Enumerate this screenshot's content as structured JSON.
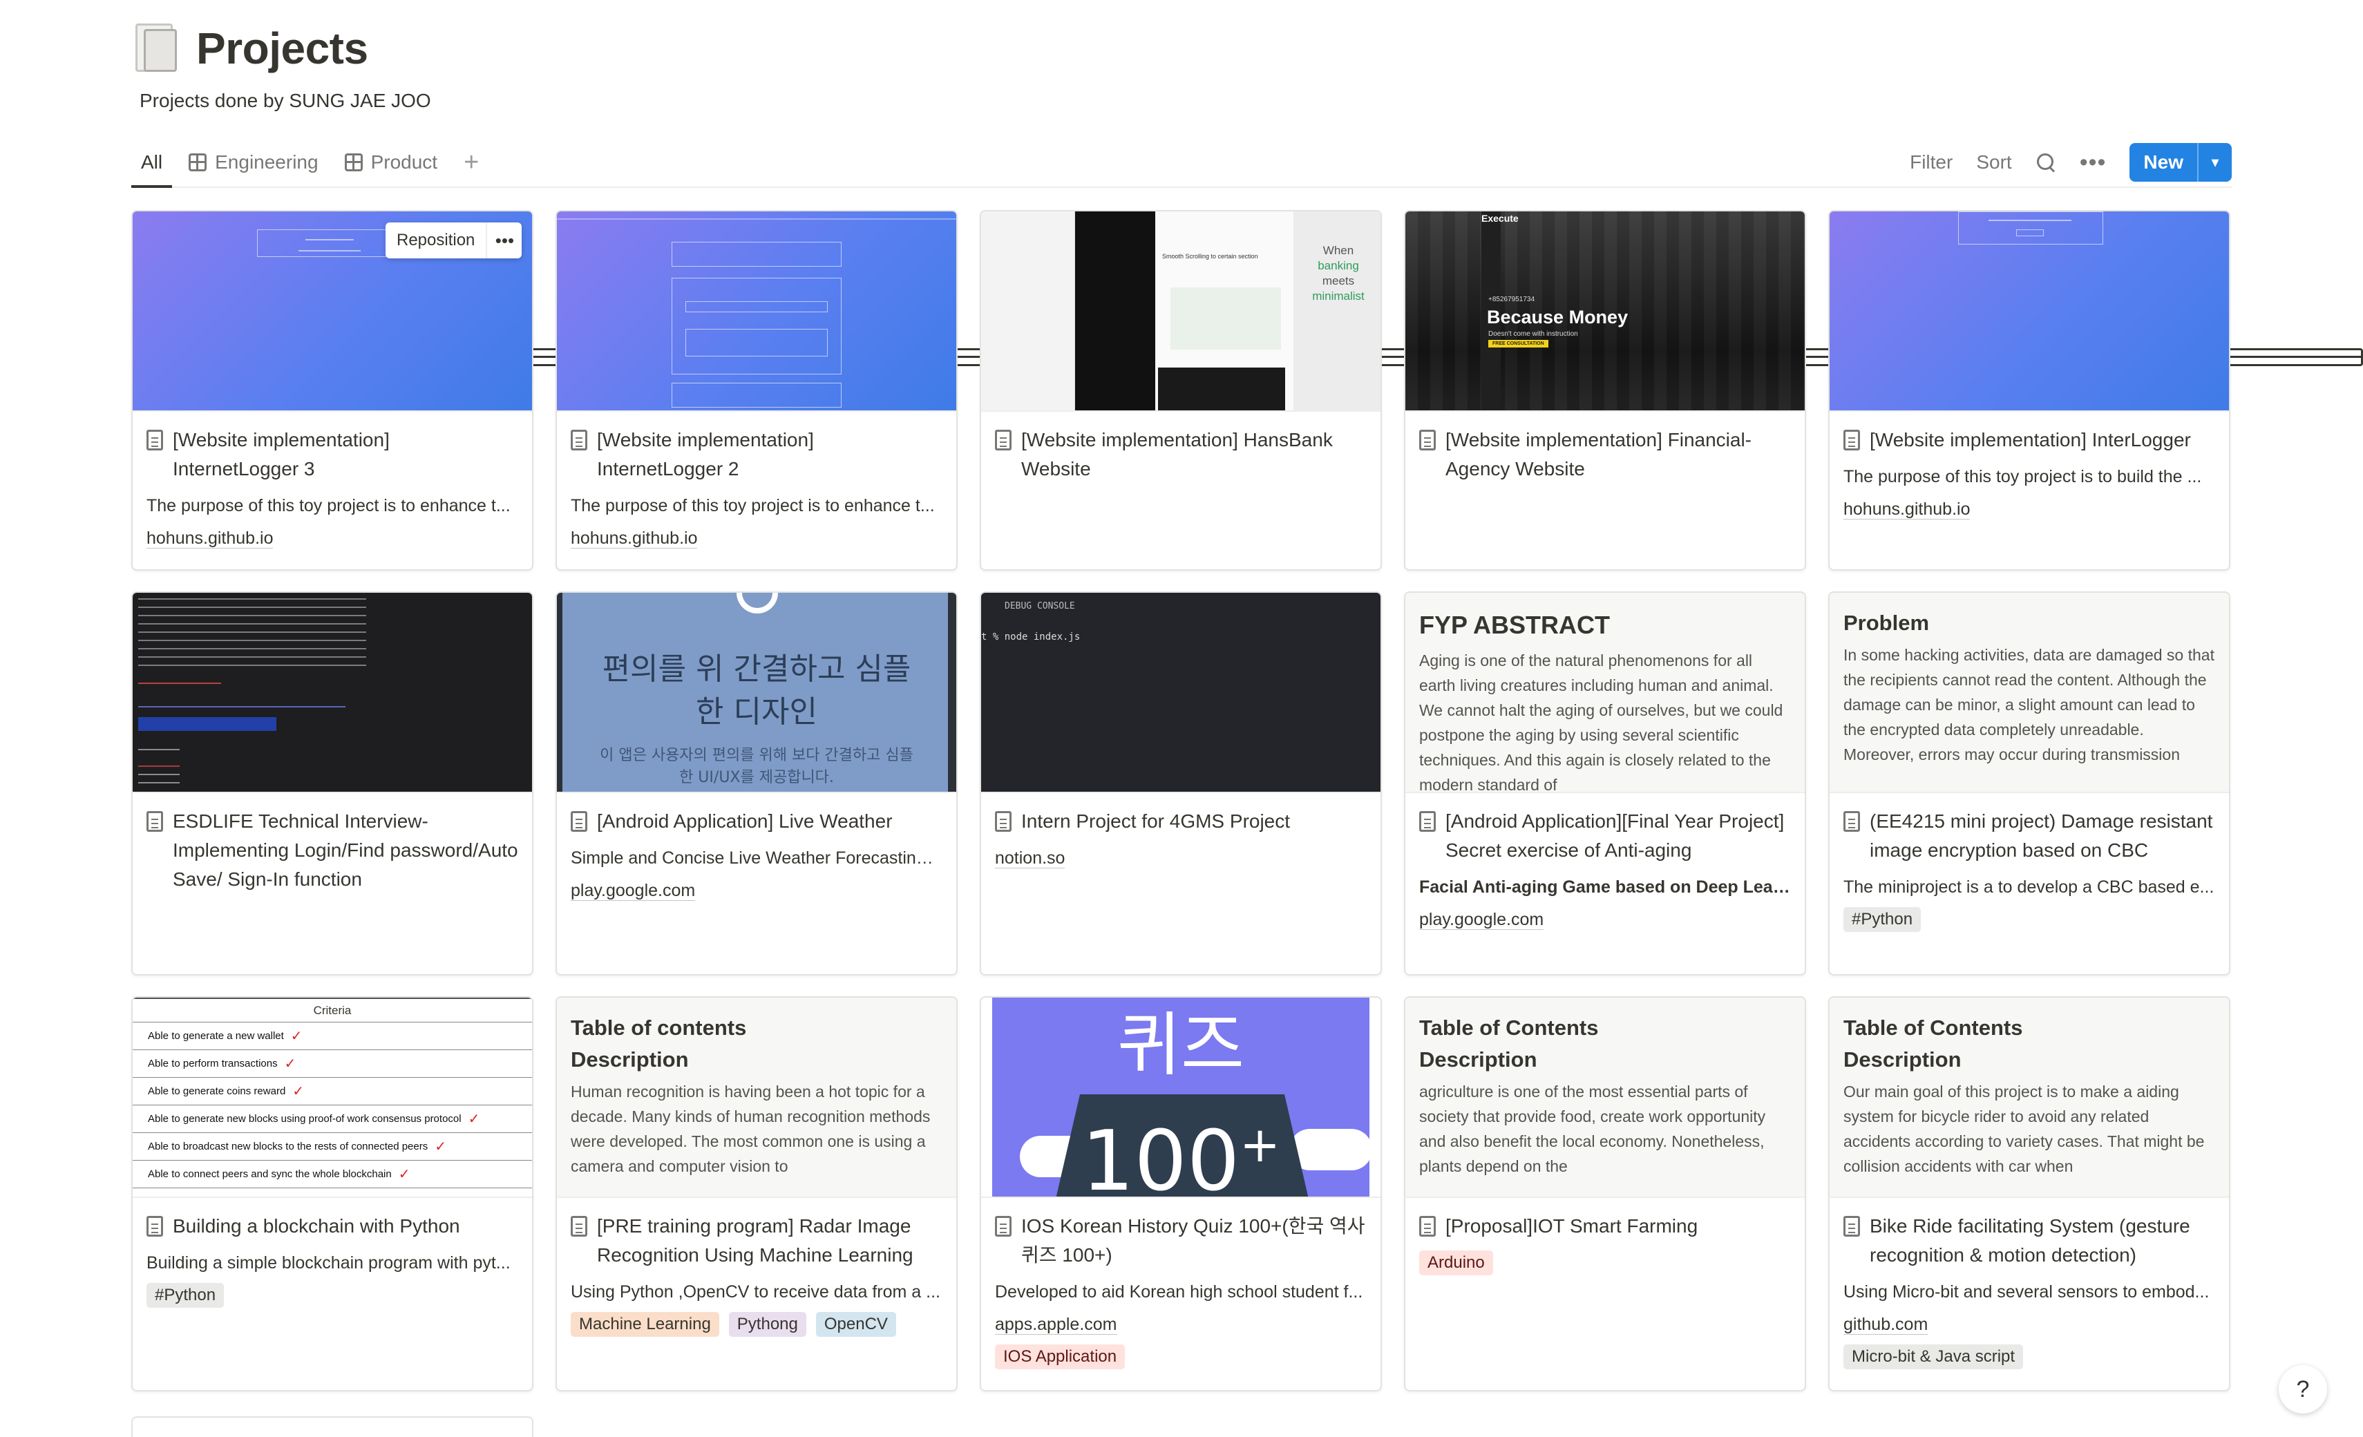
{
  "page": {
    "title": "Projects",
    "subtitle": "Projects done by SUNG JAE JOO",
    "icon": "document-stack-icon"
  },
  "toolbar": {
    "tabs": [
      {
        "label": "All",
        "icon": "gallery-icon",
        "active": true
      },
      {
        "label": "Engineering",
        "icon": "table-icon",
        "active": false
      },
      {
        "label": "Product",
        "icon": "table-icon",
        "active": false
      }
    ],
    "add_view": "+",
    "filter": "Filter",
    "sort": "Sort",
    "more": "•••",
    "new_label": "New",
    "new_caret": "⌄"
  },
  "reposition": {
    "label": "Reposition",
    "more": "•••"
  },
  "cards": [
    {
      "title": "[Website implementation] InternetLogger 3",
      "desc": "The purpose of this toy project is to enhance t...",
      "link": "hohuns.github.io",
      "cover": "purple-gradient-login"
    },
    {
      "title": "[Website implementation] InternetLogger 2",
      "desc": "The purpose of this toy project is to enhance t...",
      "link": "hohuns.github.io",
      "cover": "purple-gradient-form"
    },
    {
      "title": "[Website implementation] HansBank Website",
      "cover": "bank-website",
      "cover_text": {
        "banner": "Smooth Scrolling to certain section",
        "right_1": "When",
        "right_2": "banking",
        "right_3": "meets",
        "right_4": "minimalist"
      }
    },
    {
      "title": "[Website implementation] Financial-Agency Website",
      "cover": "dark-building",
      "cover_text": {
        "brand": "Execute",
        "phone": "+85267951734",
        "headline": "Because Money",
        "tagline": "Doesn't come with instruction",
        "cta": "FREE CONSULTATION"
      }
    },
    {
      "title": "[Website implementation] InterLogger",
      "desc": "The purpose of this toy project is to build the ...",
      "link": "hohuns.github.io",
      "cover": "purple-gradient-simple"
    },
    {
      "title": "ESDLIFE Technical Interview- Implementing Login/Find password/Auto Save/ Sign-In function",
      "cover": "dark-email"
    },
    {
      "title": "[Android Application] Live Weather",
      "desc": "Simple and Concise Live Weather Forecasting ...",
      "link": "play.google.com",
      "cover": "korean-blue",
      "cover_text": {
        "line1": "편의를 위 간결하고 심플",
        "line2": "한 디자인",
        "sub1": "이 앱은 사용자의 편의를 위해 보다 간결하고 심플",
        "sub2": "한 UI/UX를 제공합니다."
      }
    },
    {
      "title": "Intern Project for 4GMS Project",
      "link": "notion.so",
      "cover": "debug-console",
      "cover_text": {
        "console": "DEBUG CONSOLE",
        "command": "t % node index.js"
      }
    },
    {
      "title": "[Android Application][Final Year Project] Secret exercise of Anti-aging",
      "desc_bold": "Facial Anti-aging Game based on Deep Lear...",
      "link": "play.google.com",
      "cover": "text-page",
      "cover_text": {
        "heading": "FYP ABSTRACT",
        "body": "Aging is one of the natural phenomenons for all earth living creatures including human and animal. We cannot halt the aging of ourselves, but we could postpone the aging by using several scientific techniques. And this again is closely related to the modern standard of"
      }
    },
    {
      "title": "(EE4215 mini project) Damage resistant image encryption based on CBC",
      "desc": "The miniproject is a to develop a CBC based e...",
      "tags": [
        {
          "label": "#Python",
          "color": "#e9e9e7"
        }
      ],
      "cover": "text-page",
      "cover_text": {
        "heading": "Problem",
        "body": "In some hacking activities, data are damaged so that the recipients cannot read the content. Although the damage can be minor, a slight amount can lead to the encrypted data completely unreadable. Moreover, errors may occur during transmission"
      }
    },
    {
      "title": "Building a blockchain with Python",
      "desc": "Building a simple blockchain program with pyt...",
      "tags": [
        {
          "label": "#Python",
          "color": "#e9e9e7"
        }
      ],
      "cover": "criteria-table",
      "cover_text": {
        "header": "Criteria",
        "rows": [
          "Able to generate a new wallet",
          "Able to perform transactions",
          "Able to generate coins reward",
          "Able to generate new blocks using proof-of work  consensus protocol",
          "Able to broadcast new blocks to the rests of connected peers",
          "Able to connect peers and sync the whole blockchain"
        ]
      }
    },
    {
      "title": "[PRE training program] Radar Image Recognition Using Machine Learning",
      "desc": "Using Python ,OpenCV to receive data from a ...",
      "tags": [
        {
          "label": "Machine Learning",
          "color": "#fadec9"
        },
        {
          "label": "Pythong",
          "color": "#e8deee"
        },
        {
          "label": "OpenCV",
          "color": "#d3e5ef"
        }
      ],
      "cover": "text-page",
      "cover_text": {
        "heading": "Table of contents",
        "sub": "Description",
        "body": "Human recognition is having been a hot topic for a decade. Many kinds of human recognition methods were developed. The most common one is using a camera and computer vision to"
      }
    },
    {
      "title": "IOS Korean History Quiz 100+(한국 역사 퀴즈 100+)",
      "desc": "Developed to aid Korean high school student f...",
      "link": "apps.apple.com",
      "tags": [
        {
          "label": "IOS Application",
          "color": "#ffe2dd"
        }
      ],
      "cover": "quiz",
      "cover_text": {
        "line1": "퀴즈",
        "line2": "100",
        "plus": "+"
      }
    },
    {
      "title": "[Proposal]IOT Smart Farming",
      "tags": [
        {
          "label": "Arduino",
          "color": "#ffe2dd"
        }
      ],
      "cover": "text-page",
      "cover_text": {
        "heading": "Table of Contents",
        "sub": "Description",
        "body": "agriculture is one of the most essential parts of society that provide food, create work opportunity and also benefit the local economy. Nonetheless, plants depend on the"
      }
    },
    {
      "title": "Bike Ride facilitating System (gesture recognition & motion detection)",
      "desc": "Using Micro-bit and several sensors to embod...",
      "link": "github.com",
      "tags": [
        {
          "label": "Micro-bit & Java script",
          "color": "#e9e9e7"
        }
      ],
      "cover": "text-page",
      "cover_text": {
        "heading": "Table of Contents",
        "sub": "Description",
        "body": "Our main goal of this project is to make a aiding system for bicycle rider to avoid any related accidents according to variety cases. That might be collision accidents with car when"
      }
    }
  ],
  "help": "?"
}
